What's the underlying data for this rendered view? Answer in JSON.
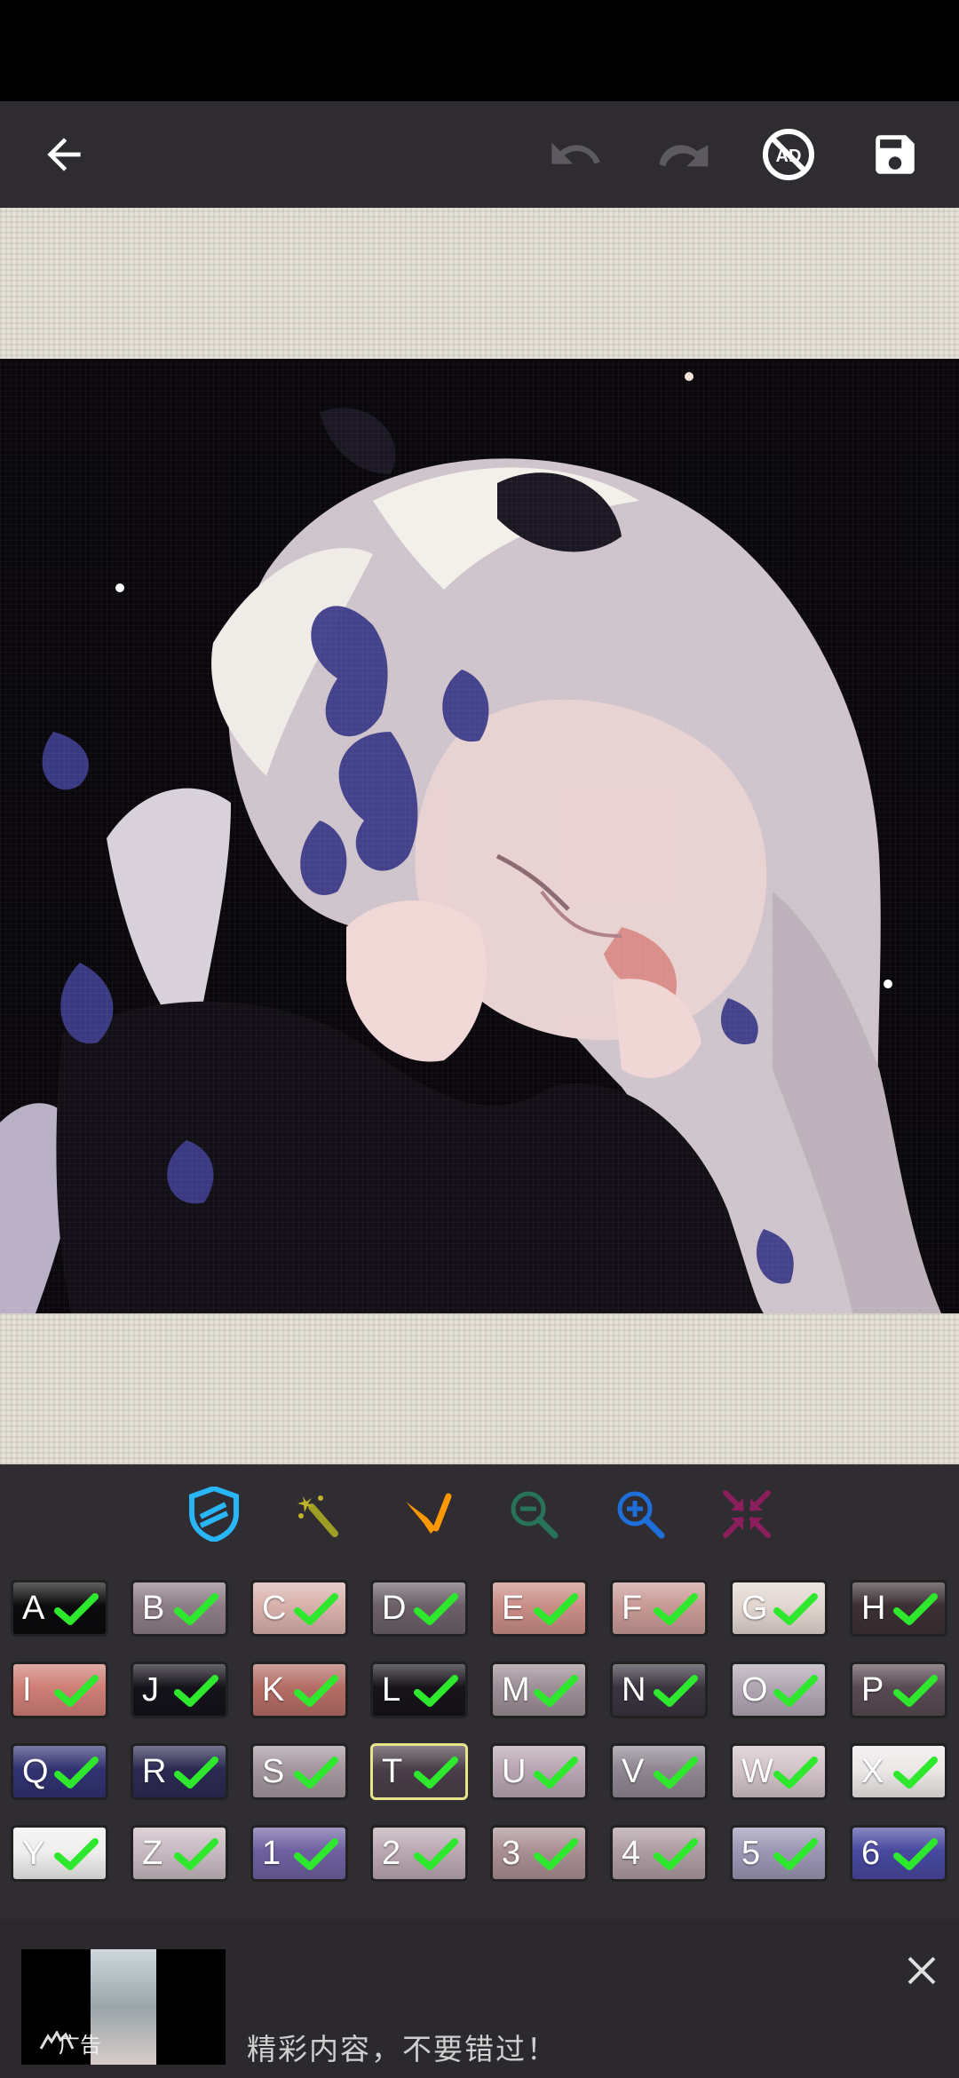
{
  "toolbar": {
    "back": "back-arrow-icon",
    "undo": "undo-icon",
    "redo": "redo-icon",
    "no_ads": "no-ads-icon",
    "no_ads_text": "AD",
    "save": "save-icon"
  },
  "tools": [
    {
      "name": "shield-tool-icon",
      "color": "#29b6f6"
    },
    {
      "name": "magic-wand-icon",
      "color": "#9e9d24"
    },
    {
      "name": "paint-tool-icon",
      "color": "#ff9800"
    },
    {
      "name": "zoom-out-icon",
      "color": "#26735a"
    },
    {
      "name": "zoom-in-icon",
      "color": "#1e6fd9"
    },
    {
      "name": "fit-screen-icon",
      "color": "#8a1f5c"
    }
  ],
  "colors": [
    {
      "label": "A",
      "color": "#0b0a0c"
    },
    {
      "label": "B",
      "color": "#8c7c86"
    },
    {
      "label": "C",
      "color": "#d9b1ac"
    },
    {
      "label": "D",
      "color": "#6c6068"
    },
    {
      "label": "E",
      "color": "#c98d86"
    },
    {
      "label": "F",
      "color": "#c89a96"
    },
    {
      "label": "G",
      "color": "#e2d6d0"
    },
    {
      "label": "H",
      "color": "#3c3034"
    },
    {
      "label": "I",
      "color": "#cf7e76"
    },
    {
      "label": "J",
      "color": "#15121a"
    },
    {
      "label": "K",
      "color": "#b56d66"
    },
    {
      "label": "L",
      "color": "#17141a"
    },
    {
      "label": "M",
      "color": "#9c8e96"
    },
    {
      "label": "N",
      "color": "#3a3440"
    },
    {
      "label": "O",
      "color": "#b2a6b4"
    },
    {
      "label": "P",
      "color": "#584a52"
    },
    {
      "label": "Q",
      "color": "#323272"
    },
    {
      "label": "R",
      "color": "#2c2a52"
    },
    {
      "label": "S",
      "color": "#a3969e"
    },
    {
      "label": "T",
      "color": "#4a3e48"
    },
    {
      "label": "U",
      "color": "#b8a6b2"
    },
    {
      "label": "V",
      "color": "#8f8692"
    },
    {
      "label": "W",
      "color": "#d2c3c8"
    },
    {
      "label": "X",
      "color": "#ece9e8"
    },
    {
      "label": "Y",
      "color": "#f0efee"
    },
    {
      "label": "Z",
      "color": "#c8bac2"
    },
    {
      "label": "1",
      "color": "#6e60a0"
    },
    {
      "label": "2",
      "color": "#bba8b2"
    },
    {
      "label": "3",
      "color": "#a98e92"
    },
    {
      "label": "4",
      "color": "#ae9ca2"
    },
    {
      "label": "5",
      "color": "#9c96b4"
    },
    {
      "label": "6",
      "color": "#4848a0"
    }
  ],
  "selected_color": "T",
  "ad": {
    "label": "广告",
    "text": "精彩内容，不要错过！",
    "close": "close-icon"
  }
}
